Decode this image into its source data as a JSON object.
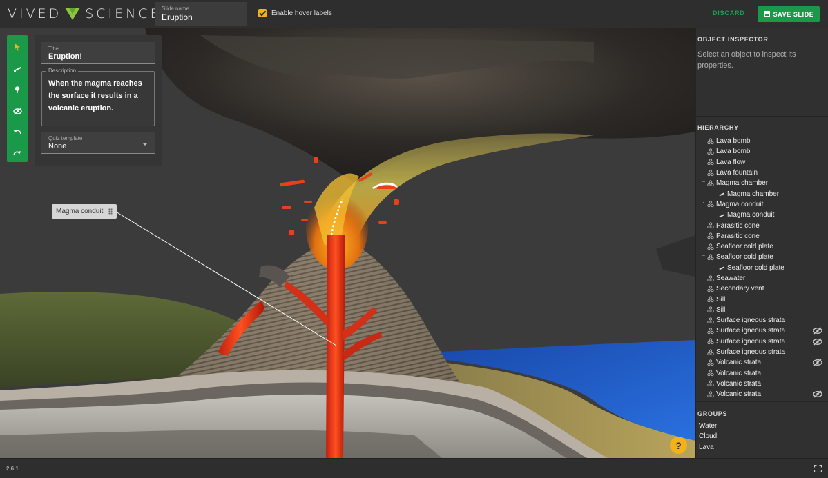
{
  "app": {
    "logo_left": "VIVED",
    "logo_right": "SCIENCE",
    "version": "2.6.1"
  },
  "toolbar": {
    "slide_name_label": "Slide name",
    "slide_name_value": "Eruption",
    "hover_labels_text": "Enable hover labels",
    "hover_labels_checked": true,
    "discard_label": "DISCARD",
    "save_label": "SAVE SLIDE",
    "accent_color": "#1a9a48",
    "highlight_color": "#f2b21a"
  },
  "tools": [
    "select-tool-icon",
    "draw-line-icon",
    "pin-icon",
    "hide-icon",
    "undo-icon",
    "redo-icon"
  ],
  "slide_panel": {
    "title_label": "Title",
    "title_value": "Eruption!",
    "description_label": "Description",
    "description_value": "When the magma reaches the surface it results in a volcanic eruption.",
    "quiz_label": "Quiz template",
    "quiz_value": "None"
  },
  "hover_label": {
    "text": "Magma conduit"
  },
  "inspector": {
    "title": "OBJECT INSPECTOR",
    "message": "Select an object to inspect its properties."
  },
  "hierarchy": {
    "title": "HIERARCHY",
    "items": [
      {
        "label": "Lava bomb",
        "level": 0,
        "expanded": false,
        "hidden": false
      },
      {
        "label": "Lava bomb",
        "level": 0,
        "expanded": false,
        "hidden": false
      },
      {
        "label": "Lava flow",
        "level": 0,
        "expanded": false,
        "hidden": false
      },
      {
        "label": "Lava fountain",
        "level": 0,
        "expanded": false,
        "hidden": false
      },
      {
        "label": "Magma chamber",
        "level": 0,
        "expanded": true,
        "hidden": false
      },
      {
        "label": "Magma chamber",
        "level": 1,
        "expanded": false,
        "hidden": false
      },
      {
        "label": "Magma conduit",
        "level": 0,
        "expanded": true,
        "hidden": false
      },
      {
        "label": "Magma conduit",
        "level": 1,
        "expanded": false,
        "hidden": false
      },
      {
        "label": "Parasitic cone",
        "level": 0,
        "expanded": false,
        "hidden": false
      },
      {
        "label": "Parasitic cone",
        "level": 0,
        "expanded": false,
        "hidden": false
      },
      {
        "label": "Seafloor cold plate",
        "level": 0,
        "expanded": false,
        "hidden": false
      },
      {
        "label": "Seafloor cold plate",
        "level": 0,
        "expanded": true,
        "hidden": false
      },
      {
        "label": "Seafloor cold plate",
        "level": 1,
        "expanded": false,
        "hidden": false
      },
      {
        "label": "Seawater",
        "level": 0,
        "expanded": false,
        "hidden": false
      },
      {
        "label": "Secondary vent",
        "level": 0,
        "expanded": false,
        "hidden": false
      },
      {
        "label": "Sill",
        "level": 0,
        "expanded": false,
        "hidden": false
      },
      {
        "label": "Sill",
        "level": 0,
        "expanded": false,
        "hidden": false
      },
      {
        "label": "Surface igneous strata",
        "level": 0,
        "expanded": false,
        "hidden": false
      },
      {
        "label": "Surface igneous strata",
        "level": 0,
        "expanded": false,
        "hidden": true
      },
      {
        "label": "Surface igneous strata",
        "level": 0,
        "expanded": false,
        "hidden": true
      },
      {
        "label": "Surface igneous strata",
        "level": 0,
        "expanded": false,
        "hidden": false
      },
      {
        "label": "Volcanic strata",
        "level": 0,
        "expanded": false,
        "hidden": true
      },
      {
        "label": "Volcanic strata",
        "level": 0,
        "expanded": false,
        "hidden": false
      },
      {
        "label": "Volcanic strata",
        "level": 0,
        "expanded": false,
        "hidden": false
      },
      {
        "label": "Volcanic strata",
        "level": 0,
        "expanded": false,
        "hidden": true
      }
    ]
  },
  "groups": {
    "title": "GROUPS",
    "items": [
      "Water",
      "Cloud",
      "Lava"
    ]
  },
  "help": {
    "text": "?"
  }
}
